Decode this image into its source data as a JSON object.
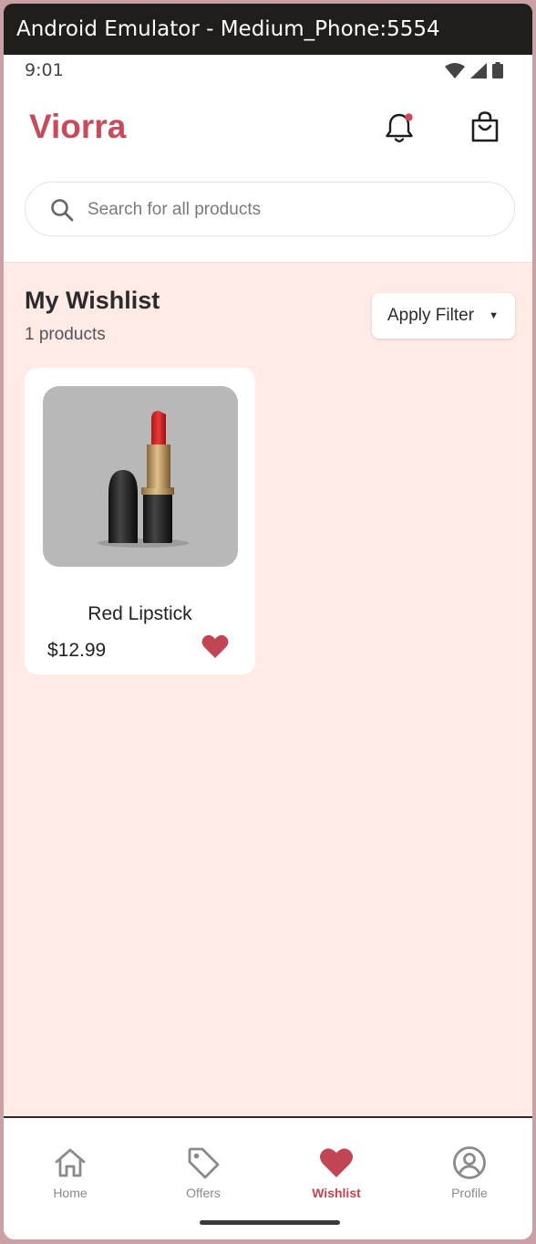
{
  "window": {
    "title": "Android Emulator - Medium_Phone:5554"
  },
  "status_bar": {
    "time": "9:01",
    "icons": [
      "wifi-icon",
      "signal-icon",
      "battery-icon"
    ]
  },
  "header": {
    "logo": "Viorra",
    "icons": [
      "bell-icon",
      "shopping-bag-icon"
    ],
    "notification_dot": true
  },
  "search": {
    "placeholder": "Search for all products",
    "value": ""
  },
  "wishlist": {
    "title": "My Wishlist",
    "count_label": "1 products",
    "filter_label": "Apply Filter",
    "items": [
      {
        "name": "Red Lipstick",
        "price": "$12.99",
        "favorited": true,
        "image": "red-lipstick-product-image"
      }
    ]
  },
  "bottom_nav": {
    "items": [
      {
        "label": "Home",
        "icon": "home-icon",
        "active": false
      },
      {
        "label": "Offers",
        "icon": "tag-icon",
        "active": false
      },
      {
        "label": "Wishlist",
        "icon": "heart-icon",
        "active": true
      },
      {
        "label": "Profile",
        "icon": "user-circle-icon",
        "active": false
      }
    ]
  },
  "colors": {
    "brand": "#c74b58",
    "active_nav": "#c14552",
    "content_bg": "#ffeae6",
    "card_bg": "#ffffff",
    "heart": "#c14552"
  }
}
